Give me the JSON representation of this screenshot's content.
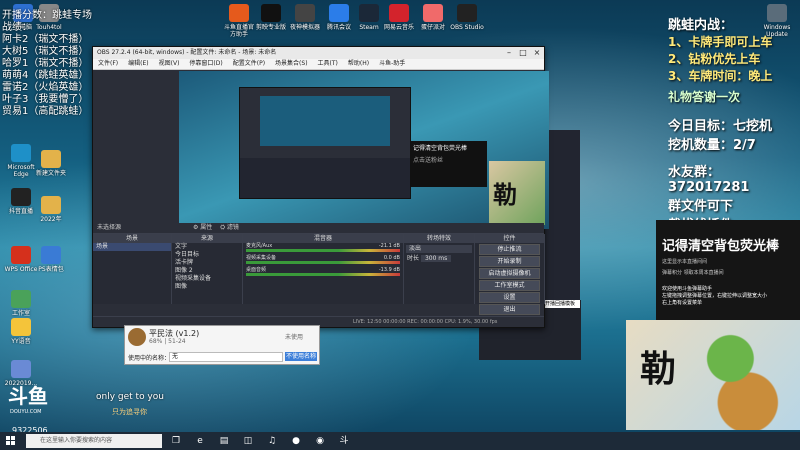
{
  "desktop": {
    "top_icons": [
      {
        "label": "主电脑",
        "color": "#2d6fd0"
      },
      {
        "label": "Touh4tol",
        "color": "#888888"
      },
      {
        "label": "斗鱼直播官方助手",
        "color": "#e55a1c"
      },
      {
        "label": "剪映专业版",
        "color": "#111111"
      },
      {
        "label": "夜神模拟器",
        "color": "#444444"
      },
      {
        "label": "腾讯会议",
        "color": "#2b7de9"
      },
      {
        "label": "Steam",
        "color": "#1b2838"
      },
      {
        "label": "网易云音乐",
        "color": "#d3232c"
      },
      {
        "label": "蛋仔派对",
        "color": "#f06a6a"
      },
      {
        "label": "OBS Studio",
        "color": "#222222"
      }
    ],
    "left_icons": [
      {
        "label": "Microsoft Edge",
        "color": "#1e90c8"
      },
      {
        "label": "新建文件夹",
        "color": "#e3b24a"
      },
      {
        "label": "抖音直播",
        "color": "#222222"
      },
      {
        "label": "2022年",
        "color": "#e3b24a"
      },
      {
        "label": "WPS Office",
        "color": "#d5301c"
      },
      {
        "label": "PS表情包",
        "color": "#3a7bd5"
      },
      {
        "label": "工作室",
        "color": "#4aa25a"
      },
      {
        "label": "YY语音",
        "color": "#f4c43a"
      },
      {
        "label": "2022019...",
        "color": "#6a8ad5"
      }
    ],
    "right_icon": {
      "label": "Windows Update",
      "color": "#5a6c7a"
    }
  },
  "overlay_left": [
    "开播分数：跳蛙专场",
    "战绩：",
    "阿卡2（瑞文不播）",
    "大树5（瑞文不播）",
    "哈罗1（瑞文不播）",
    "萌萌4（跳蛙英雄）",
    "雷诺2（火焰英雄）",
    "叶子3（我要懵了）",
    "贸易1（高配跳蛙）"
  ],
  "overlay_right": {
    "title": "跳蛙内战：",
    "items": [
      "1、卡牌手即可上车",
      "2、钻粉优先上车",
      "3、车牌时间：晚上"
    ],
    "sub": "礼物答谢一次",
    "goal": "今日目标：七挖机",
    "count": "挖机数量：2/7",
    "qq_group": "水友群：372017281",
    "line2": "群文件可下",
    "line3": "载拔线插件"
  },
  "obs": {
    "title": "OBS 27.2.4 (64-bit, windows) - 配置文件: 未命名 - 场景: 未命名",
    "menu": [
      "文件(F)",
      "编辑(E)",
      "视图(V)",
      "停靠窗口(D)",
      "配置文件(P)",
      "场景集合(S)",
      "工具(T)",
      "帮助(H)",
      "斗鱼-助手"
    ],
    "toolbar_label": "未选择源",
    "toolbar_props": "属性",
    "toolbar_filters": "滤镜",
    "panels": {
      "scenes": "场景",
      "sources": "来源",
      "mixer": "混音器",
      "transitions": "转场特效",
      "controls": "控件"
    },
    "scenes": [
      "场景"
    ],
    "sources": [
      "文字",
      "今日目标",
      "活卡牌",
      "图像 2",
      "视频采集设备",
      "图像"
    ],
    "mixer": [
      {
        "name": "麦克风/Aux",
        "db": "-21.1 dB"
      },
      {
        "name": "视频采集设备",
        "db": "0.0 dB"
      },
      {
        "name": "桌面音频",
        "db": "-13.9 dB"
      }
    ],
    "transition": {
      "type": "淡出",
      "duration_label": "时长",
      "duration": "300 ms"
    },
    "controls": [
      "停止推流",
      "开始录制",
      "启动虚拟摄像机",
      "工作室模式",
      "设置",
      "退出"
    ],
    "status": "LIVE: 12:50  00:00:00  REC: 00:00:00  CPU: 1.9%, 30.00 fps"
  },
  "preview": {
    "promo_title": "记得清空背包荧光棒",
    "promo_sub": "点击送粉丝",
    "frog_char": "勒"
  },
  "dialog": {
    "name": "平民法 (v1.2)",
    "sub": "68% | 51-24",
    "status": "未使用",
    "label": "使用中的名称：",
    "value": "无",
    "button": "不使用名称"
  },
  "right_panel": {
    "title": "记得清空背包荧光棒",
    "sub": "这里显示本直播间间",
    "line": "弹幕积分 领取本周本直播间",
    "welcome": "欢迎使用斗鱼弹幕助手\n左键拖拽调整弹幕位置，右键拉伸以调整宽大小\n右上角有设置菜单"
  },
  "mini_button": "开播回播模板",
  "frog_char": "勒",
  "brand": {
    "logo": "斗鱼",
    "domain": "DOUYU.COM"
  },
  "songs": {
    "line1": "only get to you",
    "line2": "只为追寻你"
  },
  "number_tag": "9322506",
  "taskbar": {
    "search_placeholder": "在这里输入你要搜索的内容",
    "icons": [
      "task-view-icon",
      "edge-icon",
      "folder-icon",
      "store-icon",
      "netease-icon",
      "obs-icon",
      "chrome-icon",
      "douyu-icon"
    ]
  }
}
